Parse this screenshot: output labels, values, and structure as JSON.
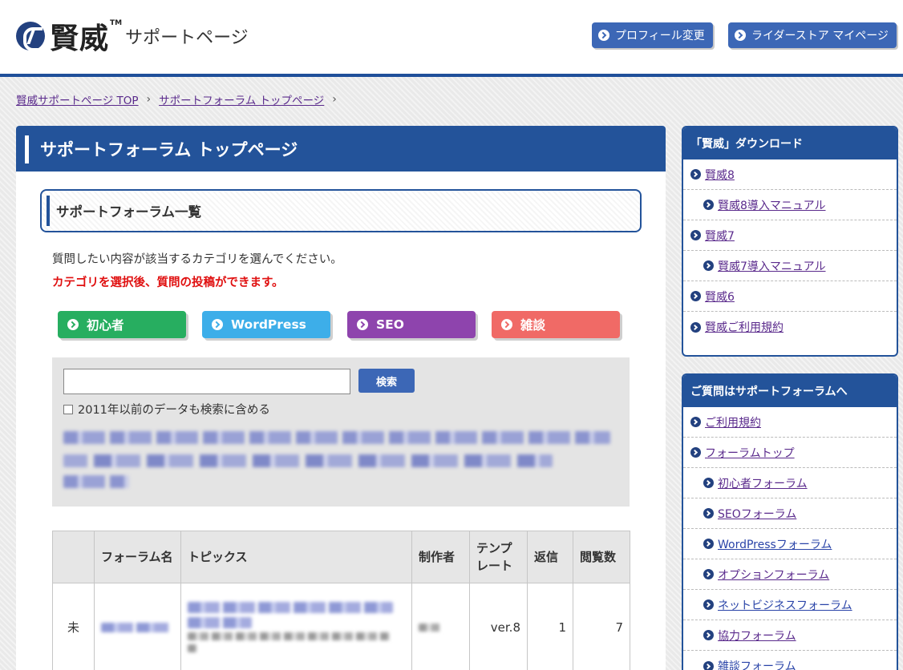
{
  "header": {
    "logo_kanji": "賢威",
    "logo_tm": "TM",
    "logo_sub": "サポートページ",
    "buttons": [
      {
        "label": "プロフィール変更"
      },
      {
        "label": "ライダーストア マイページ"
      }
    ]
  },
  "breadcrumb": {
    "items": [
      "賢威サポートページ TOP",
      "サポートフォーラム トップページ"
    ],
    "separator": "›"
  },
  "main": {
    "title": "サポートフォーラム トップページ",
    "section_title": "サポートフォーラム一覧",
    "intro": "質問したい内容が該当するカテゴリを選んでください。",
    "notice": "カテゴリを選択後、質問の投稿ができます。",
    "categories": [
      {
        "label": "初心者",
        "color": "#27ae60"
      },
      {
        "label": "WordPress",
        "color": "#3daee9"
      },
      {
        "label": "SEO",
        "color": "#8e44ad"
      },
      {
        "label": "雑談",
        "color": "#f06a66"
      }
    ],
    "search": {
      "value": "",
      "button": "検索",
      "checkbox_label": "2011年以前のデータも検索に含める"
    },
    "table": {
      "headers": [
        "",
        "フォーラム名",
        "トピックス",
        "制作者",
        "テンプレート",
        "返信",
        "閲覧数"
      ],
      "rows": [
        {
          "status": "未",
          "template": "ver.8",
          "replies": "1",
          "views": "7"
        }
      ]
    }
  },
  "sidebar": {
    "download": {
      "title": "「賢威」ダウンロード",
      "items": [
        "賢威8",
        "賢威8導入マニュアル",
        "賢威7",
        "賢威7導入マニュアル",
        "賢威6",
        "賢威ご利用規約"
      ]
    },
    "forum": {
      "title": "ご質問はサポートフォーラムへ",
      "items": [
        "ご利用規約",
        "フォーラムトップ",
        "初心者フォーラム",
        "SEOフォーラム",
        "WordPressフォーラム",
        "オプションフォーラム",
        "ネットビジネスフォーラム",
        "協力フォーラム",
        "雑談フォーラム"
      ]
    }
  }
}
